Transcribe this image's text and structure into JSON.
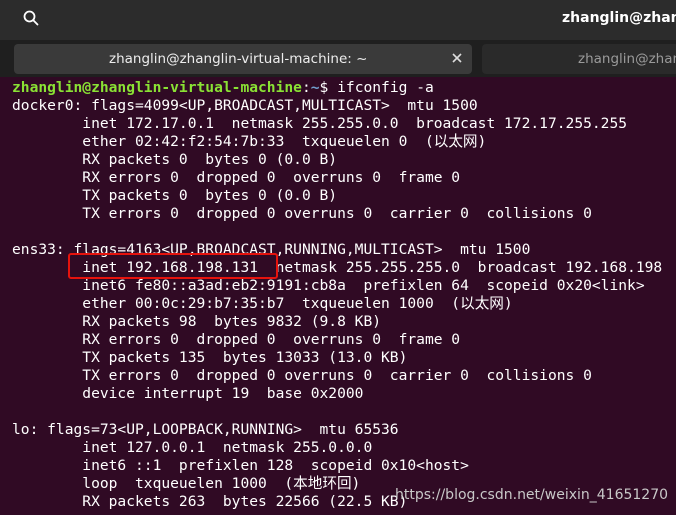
{
  "window": {
    "title": "zhanglin@zhang"
  },
  "tabs": [
    {
      "label": "zhanglin@zhanglin-virtual-machine: ~",
      "active": true
    },
    {
      "label": "zhanglin@zhanglin",
      "active": false
    }
  ],
  "icons": {
    "search": "search-icon",
    "close": "close-icon"
  },
  "colors": {
    "terminal_bg": "#300a24",
    "prompt_user": "#8ae234",
    "prompt_path": "#729fcf",
    "highlight": "#e5130d"
  },
  "terminal": {
    "prompt": {
      "user_host": "zhanglin@zhanglin-virtual-machine",
      "path": "~",
      "command": "$ ifconfig -a"
    },
    "lines": [
      "docker0: flags=4099<UP,BROADCAST,MULTICAST>  mtu 1500",
      "        inet 172.17.0.1  netmask 255.255.0.0  broadcast 172.17.255.255",
      "        ether 02:42:f2:54:7b:33  txqueuelen 0  (以太网)",
      "        RX packets 0  bytes 0 (0.0 B)",
      "        RX errors 0  dropped 0  overruns 0  frame 0",
      "        TX packets 0  bytes 0 (0.0 B)",
      "        TX errors 0  dropped 0 overruns 0  carrier 0  collisions 0",
      "",
      "ens33: flags=4163<UP,BROADCAST,RUNNING,MULTICAST>  mtu 1500",
      "        inet 192.168.198.131  netmask 255.255.255.0  broadcast 192.168.198",
      "        inet6 fe80::a3ad:eb2:9191:cb8a  prefixlen 64  scopeid 0x20<link>",
      "        ether 00:0c:29:b7:35:b7  txqueuelen 1000  (以太网)",
      "        RX packets 98  bytes 9832 (9.8 KB)",
      "        RX errors 0  dropped 0  overruns 0  frame 0",
      "        TX packets 135  bytes 13033 (13.0 KB)",
      "        TX errors 0  dropped 0 overruns 0  carrier 0  collisions 0",
      "        device interrupt 19  base 0x2000",
      "",
      "lo: flags=73<UP,LOOPBACK,RUNNING>  mtu 65536",
      "        inet 127.0.0.1  netmask 255.0.0.0",
      "        inet6 ::1  prefixlen 128  scopeid 0x10<host>",
      "        loop  txqueuelen 1000  (本地环回)",
      "        RX packets 263  bytes 22566 (22.5 KB)"
    ]
  },
  "watermark": "https://blog.csdn.net/weixin_41651270"
}
